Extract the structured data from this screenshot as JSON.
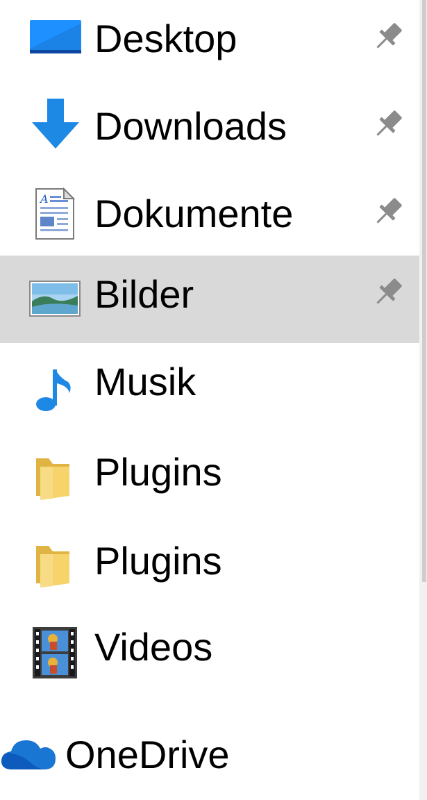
{
  "quick_access": {
    "items": [
      {
        "label": "Desktop",
        "icon": "desktop-icon",
        "pinned": true,
        "selected": false
      },
      {
        "label": "Downloads",
        "icon": "downloads-icon",
        "pinned": true,
        "selected": false
      },
      {
        "label": "Dokumente",
        "icon": "documents-icon",
        "pinned": true,
        "selected": false
      },
      {
        "label": "Bilder",
        "icon": "pictures-icon",
        "pinned": true,
        "selected": true
      },
      {
        "label": "Musik",
        "icon": "music-icon",
        "pinned": false,
        "selected": false
      },
      {
        "label": "Plugins",
        "icon": "folder-icon",
        "pinned": false,
        "selected": false
      },
      {
        "label": "Plugins",
        "icon": "folder-icon",
        "pinned": false,
        "selected": false
      },
      {
        "label": "Videos",
        "icon": "videos-icon",
        "pinned": false,
        "selected": false
      }
    ]
  },
  "onedrive": {
    "label": "OneDrive",
    "icon": "onedrive-cloud-icon"
  },
  "colors": {
    "selected_row": "#d9d9d9",
    "accent_blue": "#1e88e5",
    "folder_yellow": "#f3cf62",
    "pin_gray": "#8b8b8b"
  }
}
